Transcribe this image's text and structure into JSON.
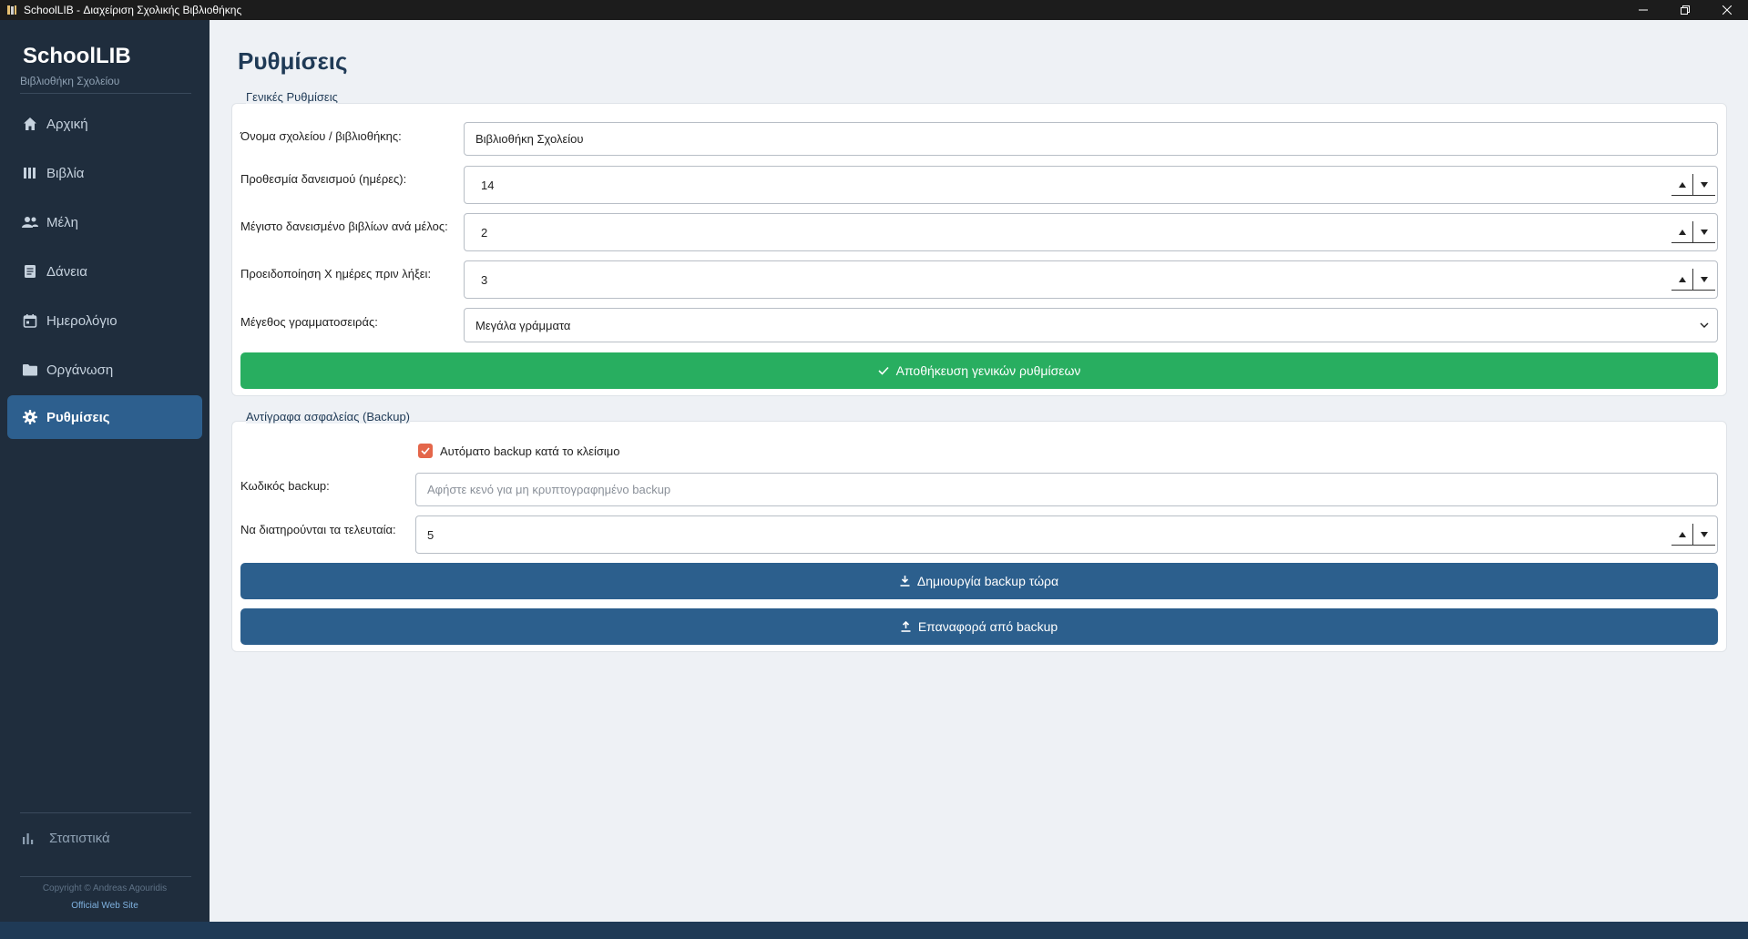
{
  "window": {
    "title": "SchoolLIB - Διαχείριση Σχολικής Βιβλιοθήκης"
  },
  "sidebar": {
    "brand": "SchoolLIB",
    "subtitle": "Βιβλιοθήκη Σχολείου",
    "items": [
      {
        "label": "Αρχική",
        "icon": "home-icon"
      },
      {
        "label": "Βιβλία",
        "icon": "books-icon"
      },
      {
        "label": "Μέλη",
        "icon": "members-icon"
      },
      {
        "label": "Δάνεια",
        "icon": "loans-icon"
      },
      {
        "label": "Ημερολόγιο",
        "icon": "calendar-icon"
      },
      {
        "label": "Οργάνωση",
        "icon": "folder-icon"
      },
      {
        "label": "Ρυθμίσεις",
        "icon": "gear-icon",
        "active": true
      }
    ],
    "stats_label": "Στατιστικά",
    "copyright": "Copyright © Andreas Agouridis",
    "website": "Official Web Site"
  },
  "page": {
    "title": "Ρυθμίσεις"
  },
  "general": {
    "group_label": "Γενικές Ρυθμίσεις",
    "school_name_label": "Όνομα σχολείου / βιβλιοθήκης:",
    "school_name_value": "Βιβλιοθήκη Σχολείου",
    "loan_days_label": "Προθεσμία δανεισμού (ημέρες):",
    "loan_days_value": "14",
    "max_books_label": "Μέγιστο δανεισμένο βιβλίων ανά μέλος:",
    "max_books_value": "2",
    "warn_days_label": "Προειδοποίηση Χ ημέρες πριν λήξει:",
    "warn_days_value": "3",
    "font_size_label": "Μέγεθος γραμματοσειράς:",
    "font_size_value": "Μεγάλα γράμματα",
    "save_button": "Αποθήκευση γενικών ρυθμίσεων"
  },
  "backup": {
    "group_label": "Αντίγραφα ασφαλείας (Backup)",
    "auto_backup_label": "Αυτόματο backup κατά το κλείσιμο",
    "auto_backup_checked": true,
    "password_label": "Κωδικός backup:",
    "password_placeholder": "Αφήστε κενό για μη κρυπτογραφημένο backup",
    "keep_last_label": "Να διατηρούνται τα τελευταία:",
    "keep_last_value": "5",
    "create_button": "Δημιουργία backup τώρα",
    "restore_button": "Επαναφορά από backup"
  },
  "colors": {
    "sidebar_bg": "#1f2d3d",
    "active_item": "#2d5f8e",
    "save_green": "#28ae60",
    "action_blue": "#2c5f8d",
    "checkbox_accent": "#e4664a"
  }
}
